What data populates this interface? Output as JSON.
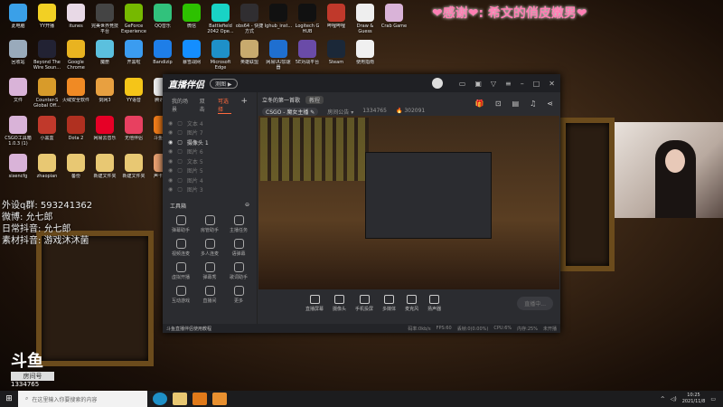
{
  "desktop": {
    "icons": [
      {
        "label": "此电脑",
        "color": "#3aa0e8"
      },
      {
        "label": "YY开播",
        "color": "#f2d024"
      },
      {
        "label": "itunes",
        "color": "#e8d9e6"
      },
      {
        "label": "完美世界竞技平台",
        "color": "#444"
      },
      {
        "label": "GeForce Experience",
        "color": "#76b900"
      },
      {
        "label": "QQ音乐",
        "color": "#31c27c"
      },
      {
        "label": "微信",
        "color": "#2dc100"
      },
      {
        "label": "Battlefield 2042 Ope...",
        "color": "#19d3c5"
      },
      {
        "label": "obs64 - 快捷方式",
        "color": "#302e31"
      },
      {
        "label": "lghub_inst...",
        "color": "#111"
      },
      {
        "label": "Logitech G HUB",
        "color": "#111"
      },
      {
        "label": "哔哩哔哩",
        "color": "#c0392b"
      },
      {
        "label": "Draw & Guess",
        "color": "#eee"
      },
      {
        "label": "Crab Game",
        "color": "#d9b3d8"
      },
      {
        "label": "回收站",
        "color": "#9ab"
      },
      {
        "label": "Beyond The Wire Soun...",
        "color": "#223"
      },
      {
        "label": "Google Chrome",
        "color": "#e9b320"
      },
      {
        "label": "魔册",
        "color": "#5bc0de"
      },
      {
        "label": "开黑啦",
        "color": "#3b9cf0"
      },
      {
        "label": "Bandizip",
        "color": "#1e7ee8"
      },
      {
        "label": "暴雪战网",
        "color": "#148eff"
      },
      {
        "label": "Microsoft Edge",
        "color": "#1e90c8"
      },
      {
        "label": "英雄联盟",
        "color": "#c8aa6e"
      },
      {
        "label": "网易UU加速器",
        "color": "#1f6fd0"
      },
      {
        "label": "5E对战平台",
        "color": "#6a4ba8"
      },
      {
        "label": "Steam",
        "color": "#1b2838"
      },
      {
        "label": "使用指南",
        "color": "#f0f0f0"
      },
      {
        "label": "文件",
        "color": "#d9b3d8"
      },
      {
        "label": "Counter-S Global Off...",
        "color": "#d89b2a"
      },
      {
        "label": "火绒安全软件",
        "color": "#f08a24"
      },
      {
        "label": "剑网3",
        "color": "#e8a040"
      },
      {
        "label": "YY语音",
        "color": "#f5c518"
      },
      {
        "label": "腾讯QQ",
        "color": "#eee"
      },
      {
        "label": "CSGO工具箱 1.0.3 (1)",
        "color": "#d9b3d8"
      },
      {
        "label": "小黑盒",
        "color": "#c0392b"
      },
      {
        "label": "Dota 2",
        "color": "#b03020"
      },
      {
        "label": "网易云音乐",
        "color": "#e60026"
      },
      {
        "label": "无他伴侣",
        "color": "#e84060"
      },
      {
        "label": "斗鱼直播",
        "color": "#f07c1a"
      },
      {
        "label": "sixencfg",
        "color": "#d9b3d8"
      },
      {
        "label": "zhaopian",
        "color": "#e8c873"
      },
      {
        "label": "备份",
        "color": "#e8c873"
      },
      {
        "label": "新建文件夹",
        "color": "#e8c873"
      },
      {
        "label": "新建文件夹",
        "color": "#e8c873"
      },
      {
        "label": "声卡调试",
        "color": "#e8a070"
      }
    ]
  },
  "thanks_banner": "❤感谢❤: 希文的俏皮嫩男❤",
  "overlay": {
    "lines": [
      "外设q群: 593241362",
      "微博: 允七郎",
      "日常抖音: 允七郎",
      "素材抖音: 游戏沐沐菌"
    ]
  },
  "douyu_logo": {
    "brand": "斗鱼",
    "tag": "房间号",
    "room": "1334765"
  },
  "app": {
    "title": "直播伴侣",
    "pill": "测图 ▶",
    "tabs": [
      "我的场景",
      "双击",
      "可选择"
    ],
    "add": "+",
    "scenes": [
      {
        "label": "文本 4",
        "active": false
      },
      {
        "label": "图片 7",
        "active": false
      },
      {
        "label": "摄像头 1",
        "active": true
      },
      {
        "label": "图片 6",
        "active": false
      },
      {
        "label": "文本 5",
        "active": false
      },
      {
        "label": "图片 5",
        "active": false
      },
      {
        "label": "图片 4",
        "active": false
      },
      {
        "label": "图片 3",
        "active": false
      }
    ],
    "toolbox_title": "工具箱",
    "tools": [
      "弹幕助手",
      "房管助手",
      "主播任务",
      "视频连麦",
      "多人连麦",
      "语弹幕",
      "虚拟开播",
      "弹幕秀",
      "歌词助手",
      "互动游戏",
      "直播间",
      "更多"
    ],
    "stream_title": "立冬的第一首歌",
    "stream_tag": "教程",
    "game": "CSGO - 魔女主播 ✎",
    "notice": "房间公告 ▾",
    "room_id": "1334765",
    "hot": "🔥 302091",
    "controls": [
      "直播屏幕",
      "摄像头",
      "手机投屏",
      "多媒体",
      "麦克风",
      "扬声器"
    ],
    "live_button": "直播中...",
    "tutorial": "斗鱼直播伴侣使用教程",
    "stats": [
      "码率:0kb/s",
      "FPS:60",
      "丢帧:0(0.00%)",
      "CPU:6%",
      "内存:25%",
      "未开播"
    ]
  },
  "taskbar": {
    "search_placeholder": "在这里输入你要搜索的内容",
    "time": "10:25",
    "date": "2021/11/8"
  }
}
